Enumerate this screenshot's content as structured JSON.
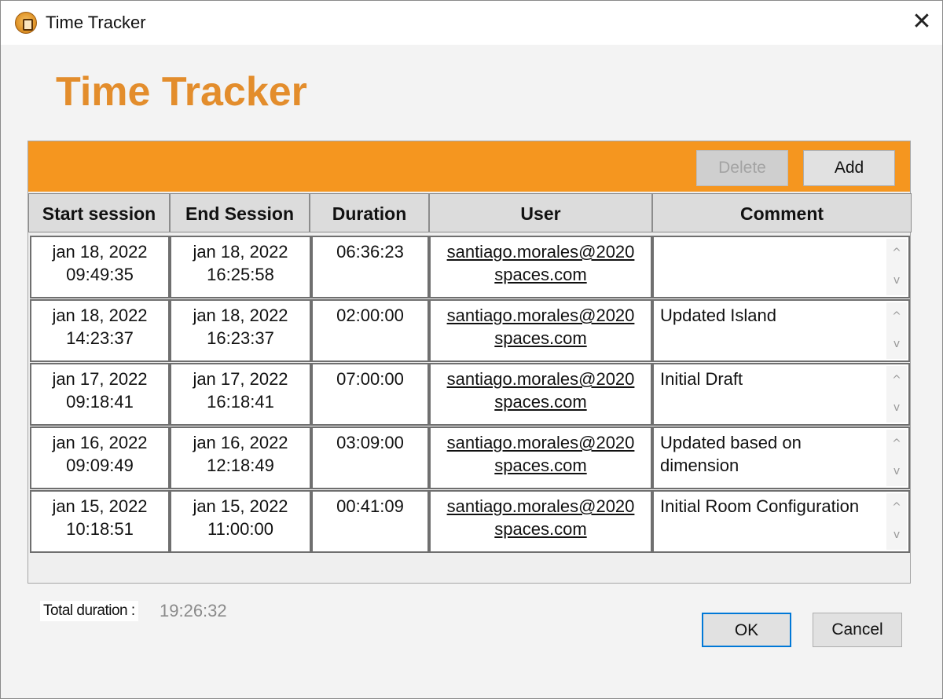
{
  "window": {
    "title": "Time Tracker",
    "close_symbol": "✕"
  },
  "heading": "Time Tracker",
  "toolbar": {
    "delete_label": "Delete",
    "add_label": "Add"
  },
  "table": {
    "columns": [
      "Start session",
      "End Session",
      "Duration",
      "User",
      "Comment"
    ],
    "rows": [
      {
        "start_date": "jan 18, 2022",
        "start_time": "09:49:35",
        "end_date": "jan 18, 2022",
        "end_time": "16:25:58",
        "duration": "06:36:23",
        "user_line1": "santiago.morales@2020",
        "user_line2": "spaces.com",
        "comment_line1": "",
        "comment_line2": ""
      },
      {
        "start_date": "jan 18, 2022",
        "start_time": "14:23:37",
        "end_date": "jan 18, 2022",
        "end_time": "16:23:37",
        "duration": "02:00:00",
        "user_line1": "santiago.morales@2020",
        "user_line2": "spaces.com",
        "comment_line1": "Updated Island",
        "comment_line2": ""
      },
      {
        "start_date": "jan 17, 2022",
        "start_time": "09:18:41",
        "end_date": "jan 17, 2022",
        "end_time": "16:18:41",
        "duration": "07:00:00",
        "user_line1": "santiago.morales@2020",
        "user_line2": "spaces.com",
        "comment_line1": "Initial Draft",
        "comment_line2": ""
      },
      {
        "start_date": "jan 16, 2022",
        "start_time": "09:09:49",
        "end_date": "jan 16, 2022",
        "end_time": "12:18:49",
        "duration": "03:09:00",
        "user_line1": "santiago.morales@2020",
        "user_line2": "spaces.com",
        "comment_line1": "Updated based on",
        "comment_line2": "dimension"
      },
      {
        "start_date": "jan 15, 2022",
        "start_time": "10:18:51",
        "end_date": "jan 15, 2022",
        "end_time": "11:00:00",
        "duration": "00:41:09",
        "user_line1": "santiago.morales@2020",
        "user_line2": "spaces.com",
        "comment_line1": "Initial Room Configuration",
        "comment_line2": ""
      }
    ],
    "scroll_up_symbol": "^",
    "scroll_down_symbol": "v"
  },
  "footer": {
    "total_label": "Total duration :",
    "total_value": "19:26:32",
    "ok_label": "OK",
    "cancel_label": "Cancel"
  },
  "colors": {
    "accent": "#f5961f",
    "heading": "#e38d2c",
    "focus_border": "#0078d7"
  }
}
